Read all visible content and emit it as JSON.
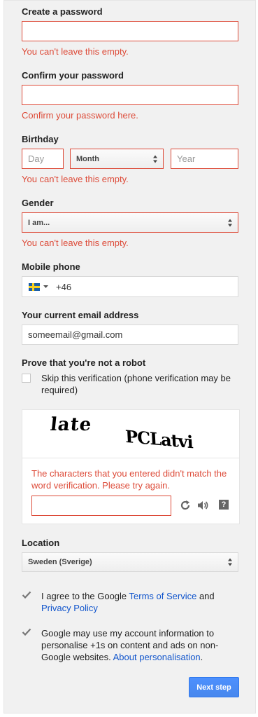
{
  "password": {
    "label": "Create a password",
    "value": "",
    "error": "You can't leave this empty."
  },
  "confirm_password": {
    "label": "Confirm your password",
    "value": "",
    "error": "Confirm your password here."
  },
  "birthday": {
    "label": "Birthday",
    "day_placeholder": "Day",
    "month_selected": "Month",
    "year_placeholder": "Year",
    "error": "You can't leave this empty."
  },
  "gender": {
    "label": "Gender",
    "selected": "I am...",
    "error": "You can't leave this empty."
  },
  "mobile": {
    "label": "Mobile phone",
    "country": "Sweden",
    "value": "+46"
  },
  "email": {
    "label": "Your current email address",
    "value": "someemail@gmail.com"
  },
  "robot": {
    "label": "Prove that you're not a robot",
    "skip_checked": false,
    "skip_text_line1": "Skip this verification (phone verification may be",
    "skip_text_line2": "required)"
  },
  "captcha": {
    "word1": "late",
    "word2": "PCLatvi",
    "error_line1": "The characters that you entered didn't match the",
    "error_line2": "word verification. Please try again.",
    "value": "",
    "icons": [
      "refresh-icon",
      "audio-icon",
      "help-icon"
    ]
  },
  "location": {
    "label": "Location",
    "selected": "Sweden (Sverige)"
  },
  "terms": {
    "checked": true,
    "prefix": "I agree to the Google ",
    "tos_link": "Terms of Service",
    "and": " and",
    "privacy_link": "Privacy Policy"
  },
  "personalise": {
    "checked": true,
    "line1": "Google may use my account information to",
    "line2": "personalise +1s on content and ads on non-",
    "line3": "Google websites. ",
    "link": "About personalisation",
    "end": "."
  },
  "next_button": "Next step",
  "colors": {
    "error": "#dd4b39",
    "link": "#1155cc",
    "primary_button": "#4d90fe",
    "panel_bg": "#f1f1f1"
  }
}
